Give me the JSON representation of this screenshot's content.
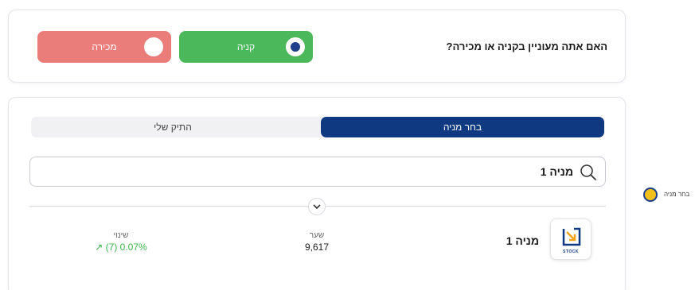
{
  "question": "האם אתה מעוניין בקניה או מכירה?",
  "choices": {
    "buy_label": "קניה",
    "sell_label": "מכירה",
    "selected": "buy"
  },
  "tabs": {
    "choose_stock": "בחר מניה",
    "my_portfolio": "התיק שלי"
  },
  "search": {
    "value": "מניה 1"
  },
  "stock": {
    "logo_word": "STOCK",
    "name": "מניה 1",
    "price_label": "שער",
    "price_value": "9,617",
    "change_label": "שינוי",
    "change_value": "↗ (7) 0.07%"
  },
  "side_step": {
    "label": "בחר מניה"
  },
  "colors": {
    "buy": "#4cb85c",
    "sell": "#ea7d79",
    "primary": "#0f3a82",
    "positive": "#3bb34a",
    "step_dot": "#f2c01a"
  }
}
